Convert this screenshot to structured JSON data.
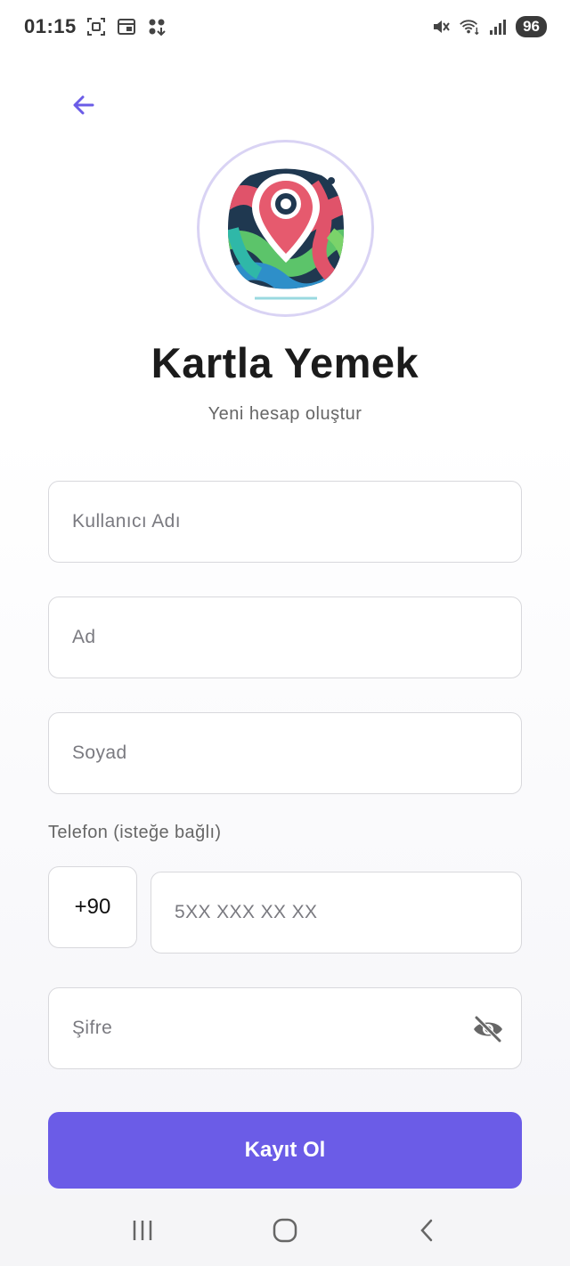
{
  "status_bar": {
    "time": "01:15",
    "battery": "96",
    "icons": [
      "screenshot-icon",
      "calendar-icon",
      "grid-icon",
      "mute-icon",
      "wifi-icon",
      "signal-icon"
    ]
  },
  "header": {
    "back_icon": "arrow-left-icon",
    "logo_icon": "map-pin-logo"
  },
  "app": {
    "title": "Kartla Yemek",
    "subtitle": "Yeni hesap oluştur"
  },
  "form": {
    "username_placeholder": "Kullanıcı Adı",
    "first_name_placeholder": "Ad",
    "last_name_placeholder": "Soyad",
    "phone_label": "Telefon (isteğe bağlı)",
    "country_code": "+90",
    "phone_placeholder": "5XX XXX XX XX",
    "password_placeholder": "Şifre",
    "password_toggle_icon": "eye-off-icon",
    "submit_label": "Kayıt Ol"
  },
  "nav": {
    "icons": [
      "recent-apps-icon",
      "home-icon",
      "back-icon"
    ]
  },
  "colors": {
    "accent": "#6b5ce7",
    "back_arrow": "#6b5ce7",
    "logo_ring": "#d9d3f4"
  }
}
